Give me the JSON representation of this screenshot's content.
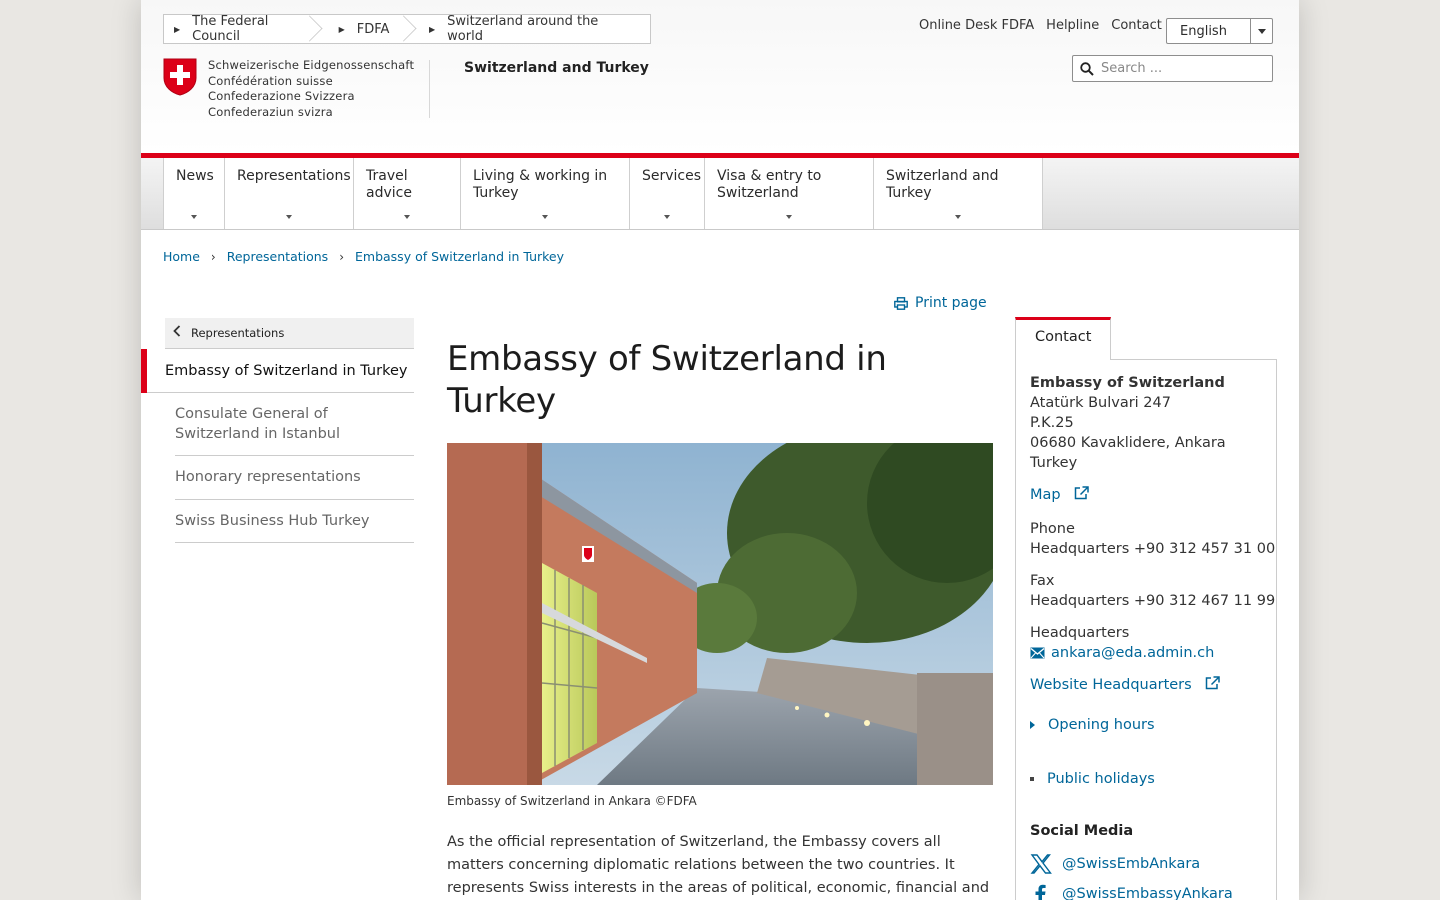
{
  "global_nav": {
    "crumbs": [
      "The Federal Council",
      "FDFA",
      "Switzerland around the world"
    ],
    "service_links": [
      "Online Desk FDFA",
      "Helpline",
      "Contact"
    ],
    "language": "English"
  },
  "search": {
    "placeholder": "Search ..."
  },
  "logo": {
    "lines": [
      "Schweizerische Eidgenossenschaft",
      "Confédération suisse",
      "Confederazione Svizzera",
      "Confederaziun svizra"
    ]
  },
  "site_title": "Switzerland and Turkey",
  "main_nav": [
    {
      "label": "News",
      "width": 61
    },
    {
      "label": "Representations"
    },
    {
      "label": "Travel advice"
    },
    {
      "label": "Living & working in Turkey"
    },
    {
      "label": "Services"
    },
    {
      "label": "Visa & entry to Switzerland"
    },
    {
      "label": "Switzerland and Turkey"
    }
  ],
  "breadcrumb": [
    "Home",
    "Representations",
    "Embassy of Switzerland in Turkey"
  ],
  "subnav": {
    "back_label": "Representations",
    "active": "Embassy of Switzerland in Turkey",
    "items": [
      "Consulate General of Switzerland in Istanbul",
      "Honorary representations",
      "Swiss Business Hub Turkey"
    ]
  },
  "content": {
    "print_label": "Print page",
    "title": "Embassy of Switzerland in Turkey",
    "image_caption": "Embassy of Switzerland in Ankara ©FDFA",
    "lead": "As the official representation of Switzerland, the Embassy covers all matters concerning diplomatic relations between the two countries. It represents Swiss interests in the areas of political, economic, financial and legal affairs,"
  },
  "contact": {
    "tab_label": "Contact",
    "name": "Embassy of Switzerland",
    "address": [
      "Atatürk Bulvari 247",
      "P.K.25",
      "06680 Kavaklidere, Ankara",
      "Turkey"
    ],
    "map_label": "Map",
    "phone_label": "Phone",
    "phone_value": "Headquarters +90 312 457 31 00",
    "fax_label": "Fax",
    "fax_value": "Headquarters +90 312 467 11 99",
    "hq_label": "Headquarters",
    "email": "ankara@eda.admin.ch",
    "website_label": "Website Headquarters",
    "opening_hours": "Opening hours",
    "public_holidays": "Public holidays",
    "social_heading": "Social Media",
    "social": [
      "@SwissEmbAnkara",
      "@SwissEmbassyAnkara"
    ]
  },
  "colors": {
    "accent_red": "#dc0018",
    "link_blue": "#006699"
  }
}
